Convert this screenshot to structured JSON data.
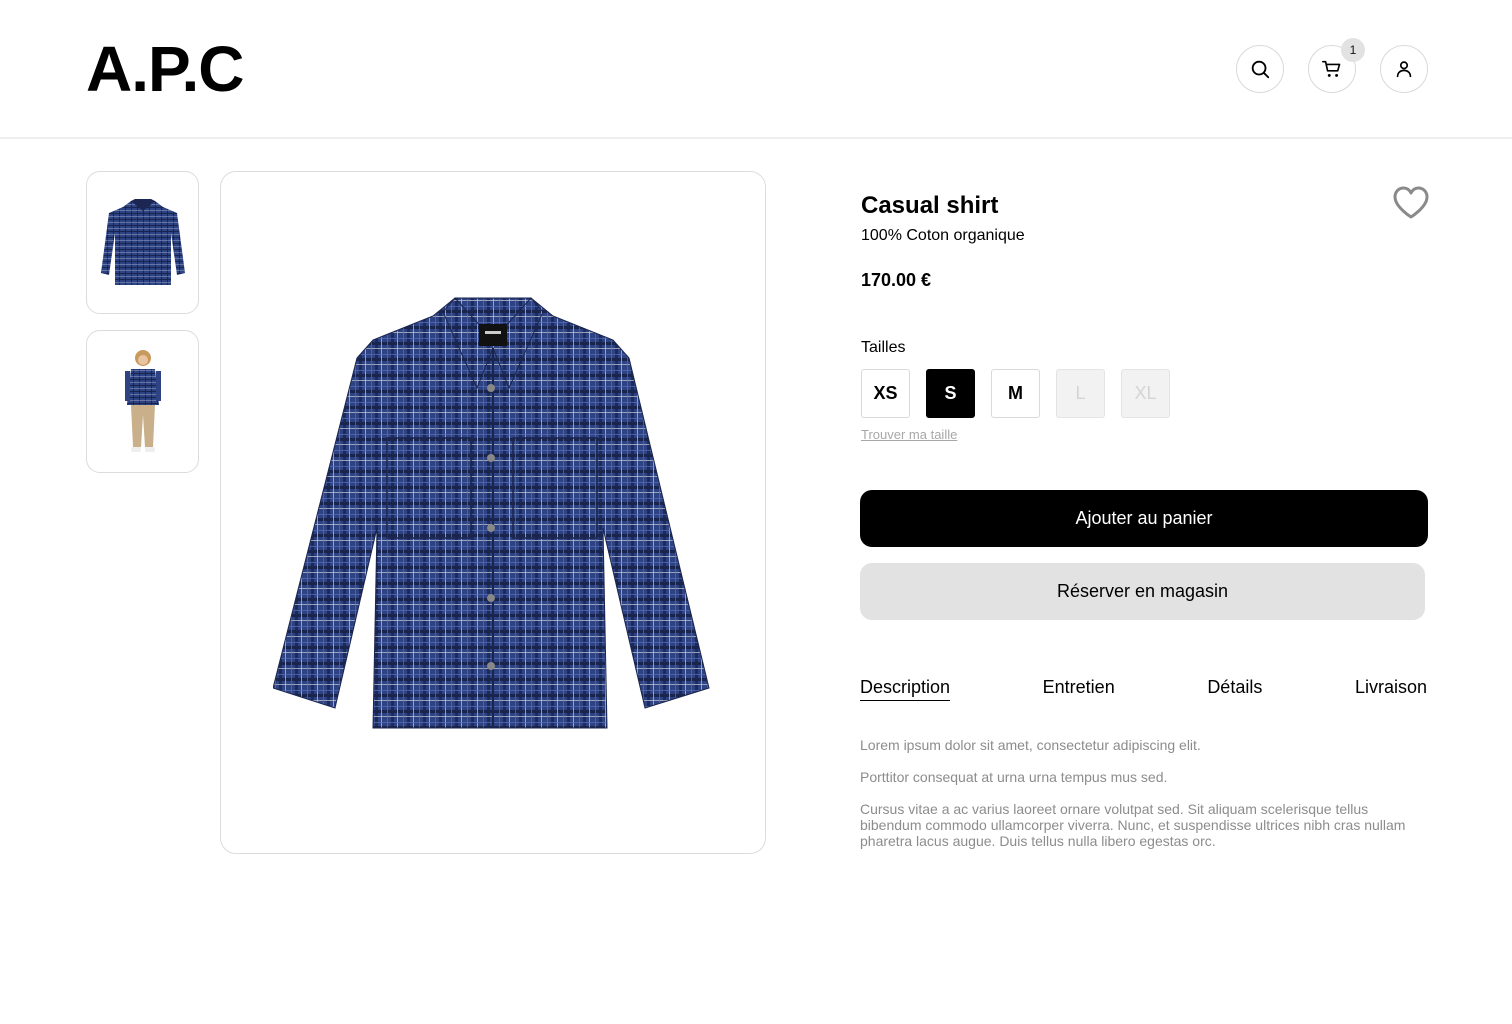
{
  "header": {
    "logo": "A.P.C",
    "cart_count": "1",
    "icons": [
      "search-icon",
      "cart-icon",
      "user-icon"
    ]
  },
  "gallery": {
    "thumbnails": [
      {
        "alt": "shirt-front-thumbnail"
      },
      {
        "alt": "model-wearing-shirt-thumbnail"
      }
    ]
  },
  "product": {
    "name": "Casual shirt",
    "material": "100% Coton organique",
    "price": "170.00 €"
  },
  "sizes": {
    "label": "Tailles",
    "options": [
      {
        "label": "XS",
        "state": "available"
      },
      {
        "label": "S",
        "state": "selected"
      },
      {
        "label": "M",
        "state": "available"
      },
      {
        "label": "L",
        "state": "disabled"
      },
      {
        "label": "XL",
        "state": "disabled"
      }
    ],
    "guide_link": "Trouver ma taille"
  },
  "actions": {
    "add_to_cart": "Ajouter au panier",
    "reserve": "Réserver en magasin"
  },
  "tabs": [
    {
      "label": "Description",
      "active": true
    },
    {
      "label": "Entretien",
      "active": false
    },
    {
      "label": "Détails",
      "active": false
    },
    {
      "label": "Livraison",
      "active": false
    }
  ],
  "description": [
    "Lorem ipsum dolor sit amet, consectetur adipiscing elit.",
    "Porttitor consequat at urna urna tempus mus sed.",
    "Cursus vitae a ac varius laoreet ornare volutpat sed. Sit aliquam scelerisque tellus bibendum commodo ullamcorper viverra. Nunc, et suspendisse ultrices nibh cras nullam pharetra lacus augue. Duis tellus nulla libero egestas orc."
  ],
  "colors": {
    "primary": "#000000",
    "secondary_button": "#e2e2e2",
    "shirt_navy": "#2b3f7a",
    "muted_text": "#8c8c8c"
  }
}
